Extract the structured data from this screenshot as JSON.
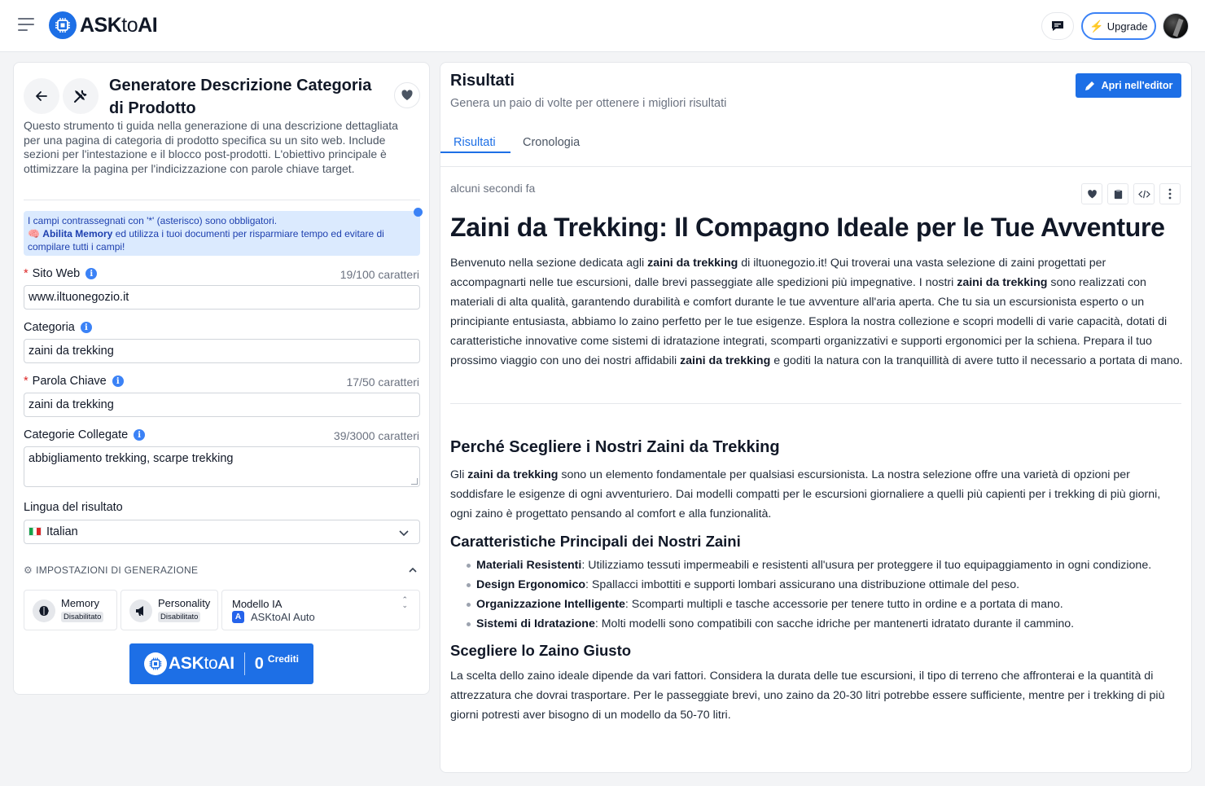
{
  "app": {
    "logo_bold": "ASK",
    "logo_light": "to",
    "logo_end": "AI"
  },
  "header": {
    "upgrade_label": "Upgrade"
  },
  "tool": {
    "title": "Generatore Descrizione Categoria di Prodotto",
    "description": "Questo strumento ti guida nella generazione di una descrizione dettagliata per una pagina di categoria di prodotto specifica su un sito web. Include sezioni per l'intestazione e il blocco post-prodotti. L'obiettivo principale è ottimizzare la pagina per l'indicizzazione con parole chiave target.",
    "notice_line1": "I campi contrassegnati con '*' (asterisco) sono obbligatori.",
    "notice_strong": "Abilita Memory",
    "notice_rest": " ed utilizza i tuoi documenti per risparmiare tempo ed evitare di compilare tutti i campi!"
  },
  "form": {
    "sito_web": {
      "label": "Sito Web",
      "counter": "19/100 caratteri",
      "value": "www.iltuonegozio.it"
    },
    "categoria": {
      "label": "Categoria",
      "value": "zaini da trekking"
    },
    "parola_chiave": {
      "label": "Parola Chiave",
      "counter": "17/50 caratteri",
      "value": "zaini da trekking"
    },
    "categorie_collegate": {
      "label": "Categorie Collegate",
      "counter": "39/3000 caratteri",
      "value": "abbigliamento trekking, scarpe trekking"
    },
    "lingua": {
      "label": "Lingua del risultato",
      "value": "Italian"
    }
  },
  "settings": {
    "heading": "IMPOSTAZIONI DI GENERAZIONE",
    "memory": {
      "title": "Memory",
      "badge": "Disabilitato"
    },
    "personality": {
      "title": "Personality",
      "badge": "Disabilitato"
    },
    "model": {
      "title": "Modello IA",
      "value": "ASKtoAI Auto"
    }
  },
  "generate": {
    "logo_bold": "ASK",
    "logo_light": "to",
    "logo_end": "AI",
    "credits_count": "0",
    "credits_label": "Crediti"
  },
  "results": {
    "title": "Risultati",
    "subtitle": "Genera un paio di volte per ottenere i migliori risultati",
    "editor_button": "Apri nell'editor",
    "tabs": [
      "Risultati",
      "Cronologia"
    ],
    "timestamp": "alcuni secondi fa"
  },
  "article": {
    "h1": "Zaini da Trekking: Il Compagno Ideale per le Tue Avventure",
    "intro": [
      "Benvenuto nella sezione dedicata agli ",
      "zaini da trekking",
      " di iltuonegozio.it! Qui troverai una vasta selezione di zaini progettati per accompagnarti nelle tue escursioni, dalle brevi passeggiate alle spedizioni più impegnative. I nostri ",
      "zaini da trekking",
      " sono realizzati con materiali di alta qualità, garantendo durabilità e comfort durante le tue avventure all'aria aperta. Che tu sia un escursionista esperto o un principiante entusiasta, abbiamo lo zaino perfetto per le tue esigenze. Esplora la nostra collezione e scopri modelli di varie capacità, dotati di caratteristiche innovative come sistemi di idratazione integrati, scomparti organizzativi e supporti ergonomici per la schiena. Prepara il tuo prossimo viaggio con uno dei nostri affidabili ",
      "zaini da trekking",
      " e goditi la natura con la tranquillità di avere tutto il necessario a portata di mano."
    ],
    "h2": "Perché Scegliere i Nostri Zaini da Trekking",
    "p2": [
      "Gli ",
      "zaini da trekking",
      " sono un elemento fondamentale per qualsiasi escursionista. La nostra selezione offre una varietà di opzioni per soddisfare le esigenze di ogni avventuriero. Dai modelli compatti per le escursioni giornaliere a quelli più capienti per i trekking di più giorni, ogni zaino è progettato pensando al comfort e alla funzionalità."
    ],
    "h3a": "Caratteristiche Principali dei Nostri Zaini",
    "features": [
      {
        "term": "Materiali Resistenti",
        "text": ": Utilizziamo tessuti impermeabili e resistenti all'usura per proteggere il tuo equipaggiamento in ogni condizione."
      },
      {
        "term": "Design Ergonomico",
        "text": ": Spallacci imbottiti e supporti lombari assicurano una distribuzione ottimale del peso."
      },
      {
        "term": "Organizzazione Intelligente",
        "text": ": Scomparti multipli e tasche accessorie per tenere tutto in ordine e a portata di mano."
      },
      {
        "term": "Sistemi di Idratazione",
        "text": ": Molti modelli sono compatibili con sacche idriche per mantenerti idratato durante il cammino."
      }
    ],
    "h3b": "Scegliere lo Zaino Giusto",
    "p3": "La scelta dello zaino ideale dipende da vari fattori. Considera la durata delle tue escursioni, il tipo di terreno che affronterai e la quantità di attrezzatura che dovrai trasportare. Per le passeggiate brevi, uno zaino da 20-30 litri potrebbe essere sufficiente, mentre per i trekking di più giorni potresti aver bisogno di un modello da 50-70 litri."
  }
}
